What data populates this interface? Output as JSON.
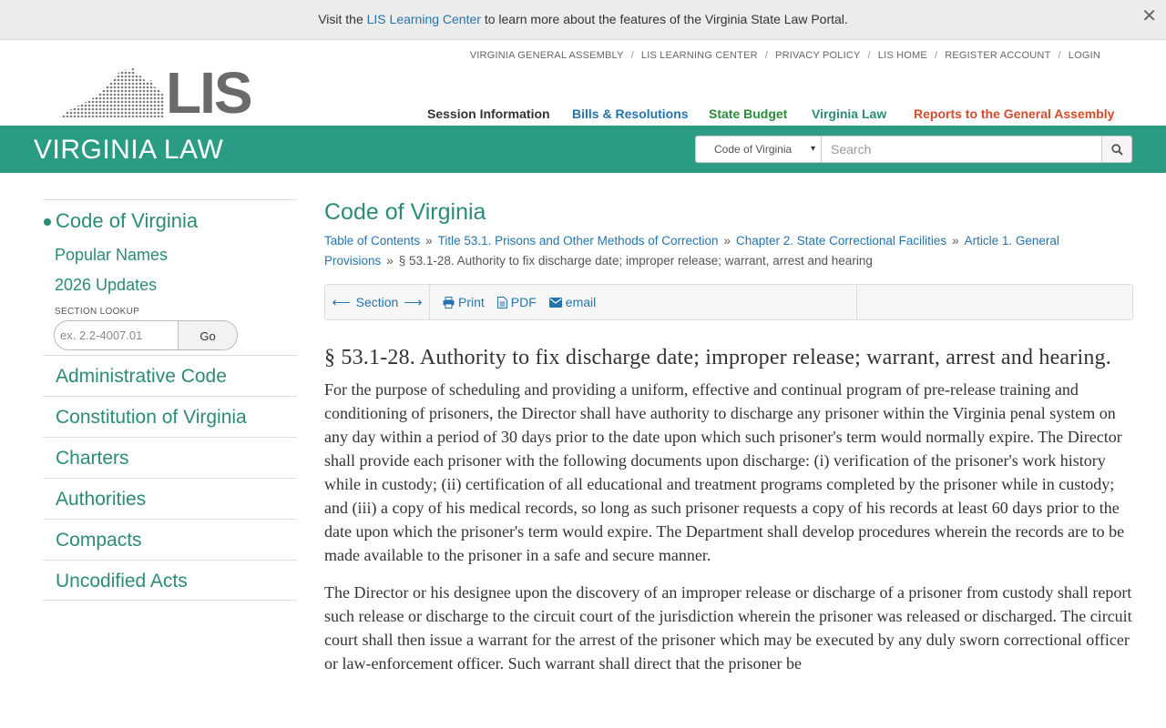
{
  "banner": {
    "prefix": "Visit the",
    "link": "LIS Learning Center",
    "suffix": "to learn more about the features of the Virginia State Law Portal."
  },
  "topnav": [
    "VIRGINIA GENERAL ASSEMBLY",
    "LIS LEARNING CENTER",
    "PRIVACY POLICY",
    "LIS HOME",
    "REGISTER ACCOUNT",
    "LOGIN"
  ],
  "logo": {
    "text": "LIS"
  },
  "mainnav": [
    {
      "label": "Session Information",
      "color": "#333333"
    },
    {
      "label": "Bills & Resolutions",
      "color": "#2474ab"
    },
    {
      "label": "State Budget",
      "color": "#2a8b3c"
    },
    {
      "label": "Virginia Law",
      "color": "#2a8b78"
    },
    {
      "label": "Reports to the General Assembly",
      "color": "#d64a2a"
    }
  ],
  "header": {
    "title": "VIRGINIA LAW",
    "search_scope": "Code of Virginia",
    "search_placeholder": "Search"
  },
  "sidebar": {
    "active": "Code of Virginia",
    "sub_items": [
      "Popular Names",
      "2026 Updates"
    ],
    "lookup_label": "SECTION LOOKUP",
    "lookup_placeholder": "ex. 2.2-4007.01",
    "lookup_button": "Go",
    "items": [
      "Administrative Code",
      "Constitution of Virginia",
      "Charters",
      "Authorities",
      "Compacts",
      "Uncodified Acts"
    ]
  },
  "content": {
    "heading": "Code of Virginia",
    "breadcrumbs": [
      "Table of Contents",
      "Title 53.1. Prisons and Other Methods of Correction",
      "Chapter 2. State Correctional Facilities",
      "Article 1. General Provisions"
    ],
    "breadcrumb_current": "§ 53.1-28. Authority to fix discharge date; improper release; warrant, arrest and hearing",
    "toolbar": {
      "section": "Section",
      "print": "Print",
      "pdf": "PDF",
      "email": "email"
    },
    "section_title": "§ 53.1-28. Authority to fix discharge date; improper release; warrant, arrest and hearing.",
    "paragraphs": [
      "For the purpose of scheduling and providing a uniform, effective and continual program of pre-release training and conditioning of prisoners, the Director shall have authority to discharge any prisoner within the Virginia penal system on any day within a period of 30 days prior to the date upon which such prisoner's term would normally expire. The Director shall provide each prisoner with the following documents upon discharge: (i) verification of the prisoner's work history while in custody; (ii) certification of all educational and treatment programs completed by the prisoner while in custody; and (iii) a copy of his medical records, so long as such prisoner requests a copy of his records at least 60 days prior to the date upon which the prisoner's term would expire. The Department shall develop procedures wherein the records are to be made available to the prisoner in a safe and secure manner.",
      "The Director or his designee upon the discovery of an improper release or discharge of a prisoner from custody shall report such release or discharge to the circuit court of the jurisdiction wherein the prisoner was released or discharged. The circuit court shall then issue a warrant for the arrest of the prisoner which may be executed by any duly sworn correctional officer or law-enforcement officer. Such warrant shall direct that the prisoner be"
    ]
  },
  "colors": {
    "accent": "#2a9c84",
    "link": "#2474ab",
    "heading_green": "#2a8b78"
  }
}
